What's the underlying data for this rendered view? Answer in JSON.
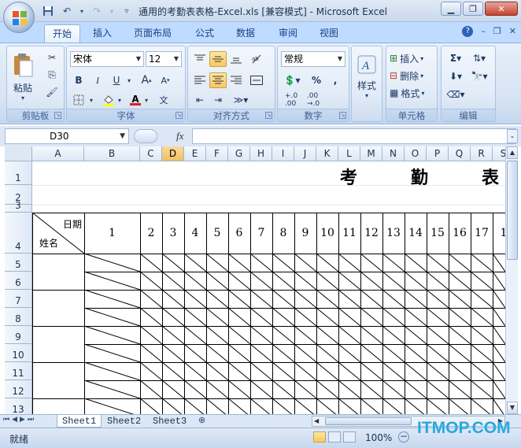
{
  "window": {
    "title": "通用的考勤表表格-Excel.xls  [兼容模式] - Microsoft Excel"
  },
  "ribbon_tabs": [
    "开始",
    "插入",
    "页面布局",
    "公式",
    "数据",
    "审阅",
    "视图"
  ],
  "active_tab": "开始",
  "groups": {
    "clipboard": {
      "label": "剪贴板",
      "paste": "粘贴"
    },
    "font": {
      "label": "字体",
      "font_name": "宋体",
      "font_size": "12"
    },
    "alignment": {
      "label": "对齐方式"
    },
    "number": {
      "label": "数字",
      "format": "常规"
    },
    "styles": {
      "label": "样式"
    },
    "cells": {
      "label": "单元格",
      "insert": "插入",
      "delete": "删除",
      "format": "格式"
    },
    "editing": {
      "label": "编辑"
    }
  },
  "formula_bar": {
    "name_box": "D30",
    "fx": "fx",
    "content": ""
  },
  "columns": [
    "A",
    "B",
    "C",
    "D",
    "E",
    "F",
    "G",
    "H",
    "I",
    "J",
    "K",
    "L",
    "M",
    "N",
    "O",
    "P",
    "Q",
    "R",
    "S"
  ],
  "selected_column": "D",
  "rows": [
    "1",
    "2",
    "3",
    "4",
    "5",
    "6",
    "7",
    "8",
    "9",
    "10",
    "11",
    "12",
    "13"
  ],
  "sheet": {
    "title_chars": [
      "考",
      "勤",
      "表"
    ],
    "header_date": "日期",
    "header_name": "姓名",
    "day_numbers": [
      "1",
      "2",
      "3",
      "4",
      "5",
      "6",
      "7",
      "8",
      "9",
      "10",
      "11",
      "12",
      "13",
      "14",
      "15",
      "16",
      "17",
      "1"
    ]
  },
  "sheet_tabs": [
    "Sheet1",
    "Sheet2",
    "Sheet3"
  ],
  "status": {
    "ready": "就绪",
    "zoom": "100%"
  },
  "watermark": "ITMOP.COM",
  "colors": {
    "ribbon_bg": "#dbe6f4",
    "tab_bar": "#bfdbff",
    "selected_header": "#f1c15f",
    "text": "#15428b"
  }
}
